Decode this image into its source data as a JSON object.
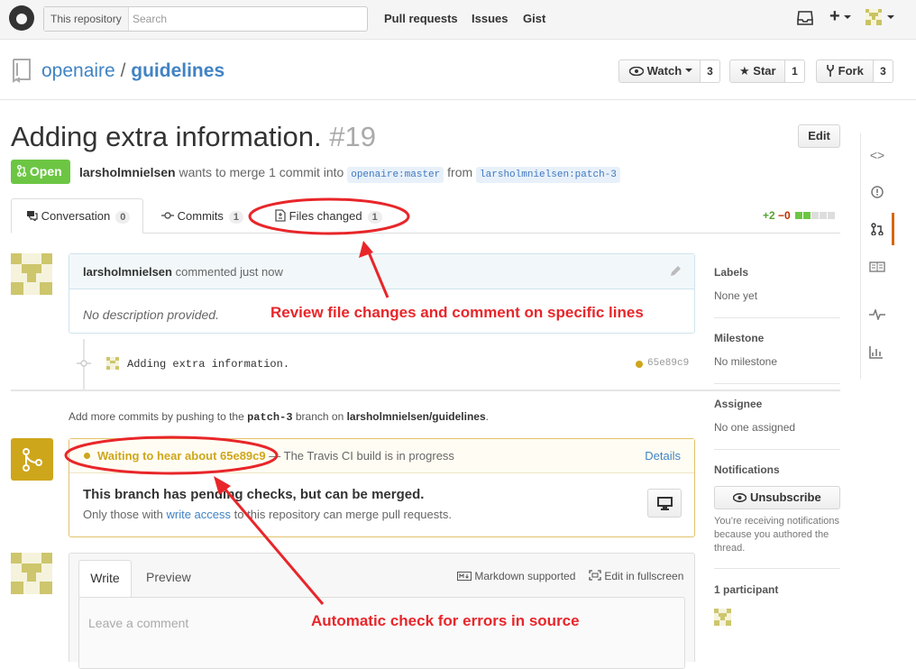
{
  "header": {
    "search_scope": "This repository",
    "search_placeholder": "Search",
    "nav": [
      "Pull requests",
      "Issues",
      "Gist"
    ],
    "plus_label": "+"
  },
  "repo": {
    "owner": "openaire",
    "separator": "/",
    "name": "guidelines",
    "watch_label": "Watch",
    "watch_count": "3",
    "star_label": "Star",
    "star_count": "1",
    "fork_label": "Fork",
    "fork_count": "3"
  },
  "pr": {
    "title": "Adding extra information.",
    "number": "#19",
    "edit_label": "Edit",
    "status": "Open",
    "author": "larsholmnielsen",
    "merge_text": "wants to merge 1 commit into",
    "base_branch": "openaire:master",
    "from_text": "from",
    "head_branch": "larsholmnielsen:patch-3"
  },
  "tabs": [
    {
      "label": "Conversation",
      "count": "0"
    },
    {
      "label": "Commits",
      "count": "1"
    },
    {
      "label": "Files changed",
      "count": "1"
    }
  ],
  "diffstat": {
    "additions": "+2",
    "deletions": "−0"
  },
  "comment": {
    "author": "larsholmnielsen",
    "action": "commented just now",
    "body": "No description provided."
  },
  "commit": {
    "message": "Adding extra information.",
    "sha": "65e89c9"
  },
  "push_hint": {
    "prefix": "Add more commits by pushing to the",
    "branch": "patch-3",
    "middle": "branch on",
    "repo": "larsholmnielsen/guidelines",
    "suffix": "."
  },
  "checks": {
    "status": "Waiting to hear about 65e89c9",
    "description": "— The Travis CI build is in progress",
    "details_label": "Details",
    "merge_title": "This branch has pending checks, but can be merged.",
    "merge_sub_prefix": "Only those with",
    "merge_sub_link": "write access",
    "merge_sub_suffix": "to this repository can merge pull requests."
  },
  "composer": {
    "write_tab": "Write",
    "preview_tab": "Preview",
    "markdown_label": "Markdown supported",
    "fullscreen_label": "Edit in fullscreen",
    "placeholder": "Leave a comment"
  },
  "sidebar": {
    "labels_title": "Labels",
    "labels_value": "None yet",
    "milestone_title": "Milestone",
    "milestone_value": "No milestone",
    "assignee_title": "Assignee",
    "assignee_value": "No one assigned",
    "notifications_title": "Notifications",
    "unsubscribe_label": "Unsubscribe",
    "notifications_note": "You’re receiving notifications because you authored the thread.",
    "participants_title": "1 participant"
  },
  "annotations": {
    "files_note": "Review file changes and comment on specific lines",
    "checks_note": "Automatic check for errors in source"
  },
  "colors": {
    "open_green": "#6cc644",
    "pending_yellow": "#cea61b",
    "link_blue": "#4183c4",
    "annotation_red": "#e8262a"
  }
}
